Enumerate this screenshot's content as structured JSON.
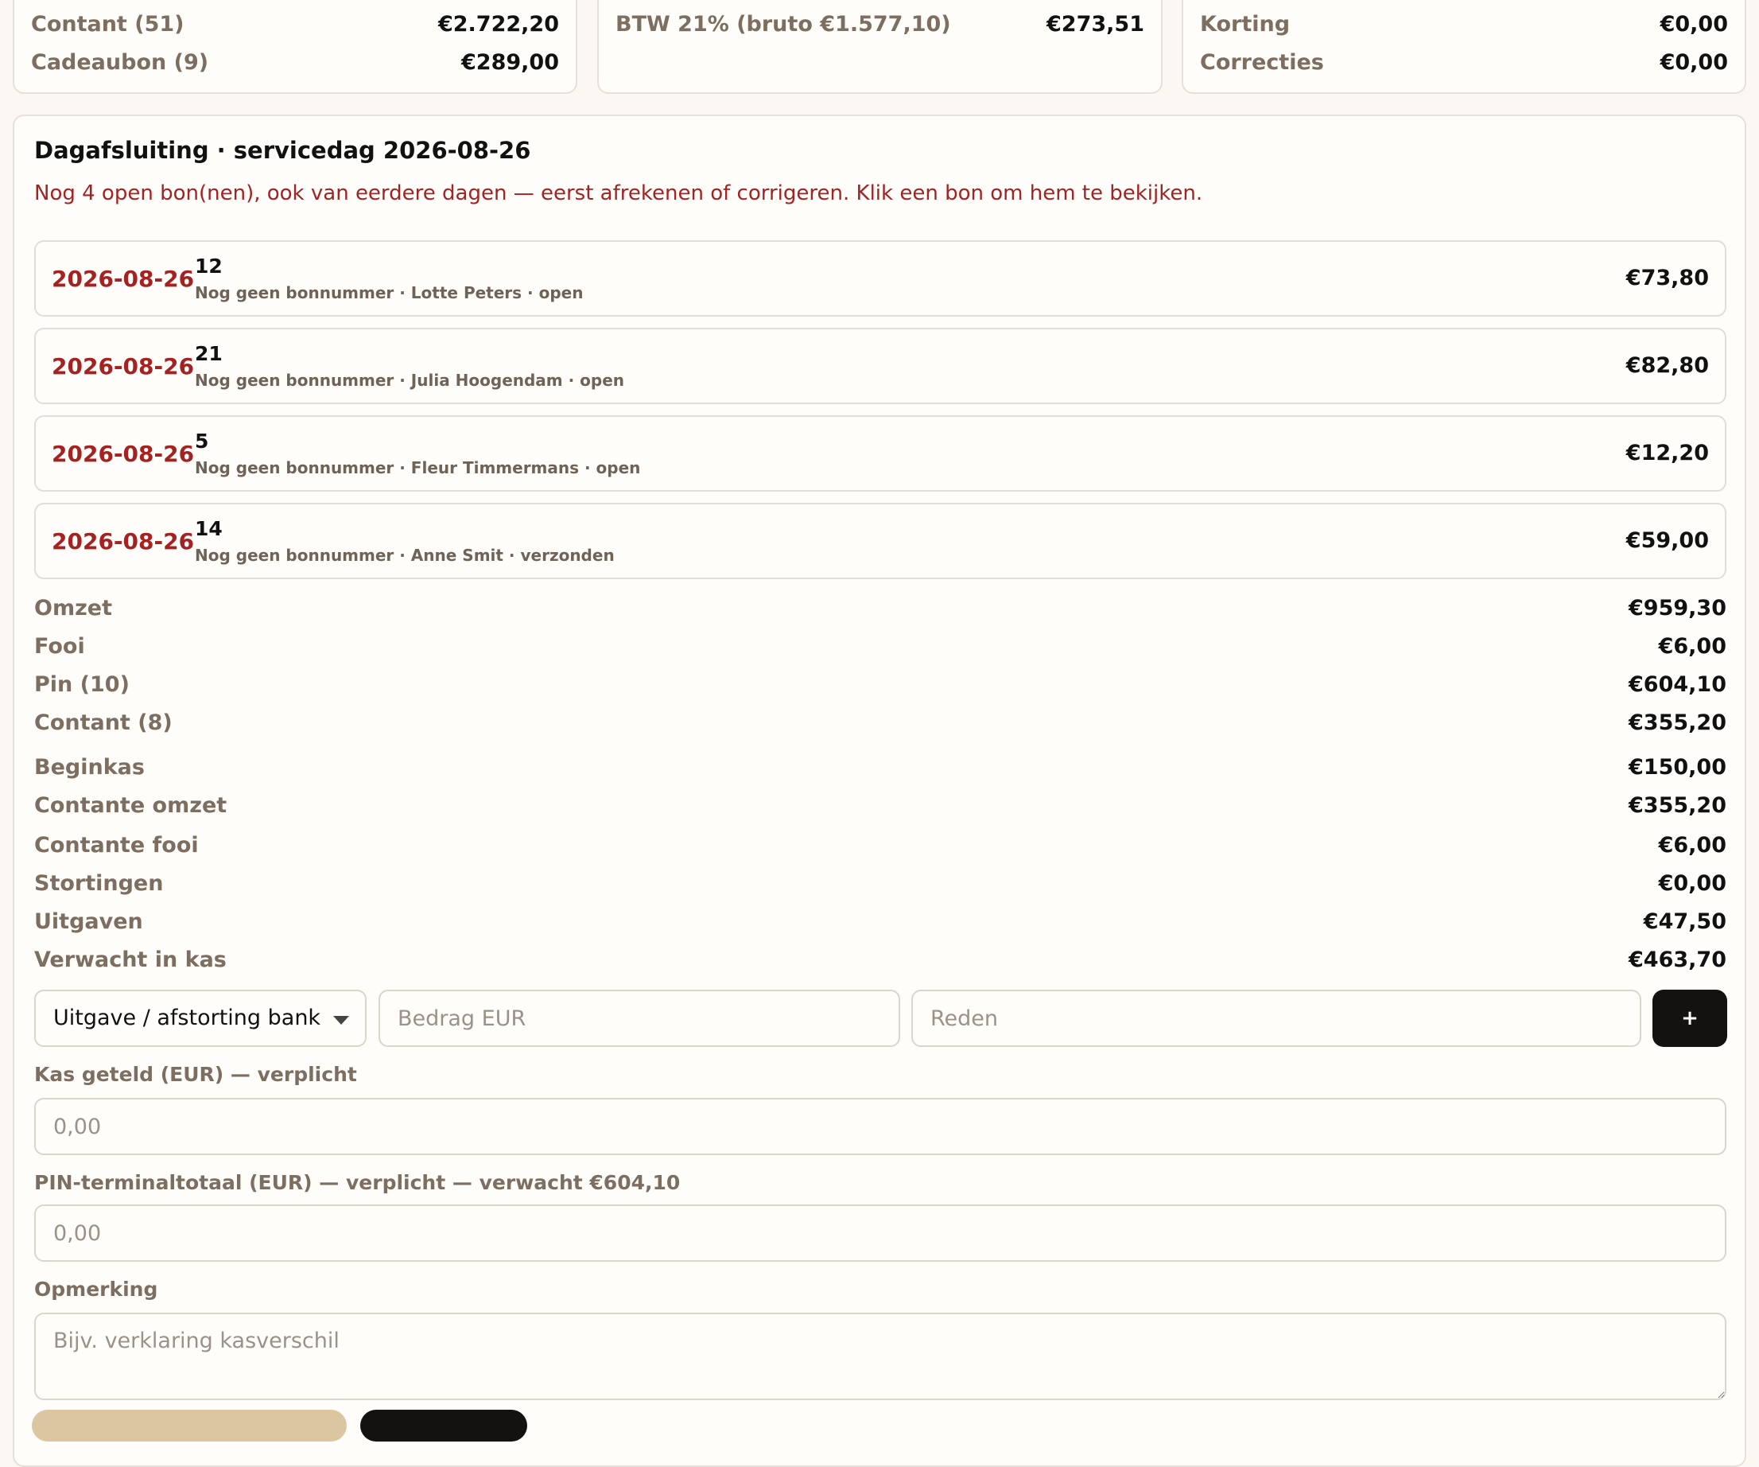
{
  "top_cards": [
    {
      "rows": [
        {
          "label": "Contant (51)",
          "value": "€2.722,20"
        },
        {
          "label": "Cadeaubon (9)",
          "value": "€289,00"
        }
      ]
    },
    {
      "rows": [
        {
          "label": "BTW 21% (bruto €1.577,10)",
          "value": "€273,51"
        }
      ]
    },
    {
      "rows": [
        {
          "label": "Korting",
          "value": "€0,00"
        },
        {
          "label": "Correcties",
          "value": "€0,00"
        }
      ]
    }
  ],
  "closing": {
    "title": "Dagafsluiting · servicedag 2026-08-26",
    "warning": "Nog 4 open bon(nen), ook van eerdere dagen — eerst afrekenen of corrigeren. Klik een bon om hem te bekijken.",
    "bons": [
      {
        "date": "2026-08-26",
        "number": "12",
        "meta": "Nog geen bonnummer · Lotte Peters · open",
        "amount": "€73,80"
      },
      {
        "date": "2026-08-26",
        "number": "21",
        "meta": "Nog geen bonnummer · Julia Hoogendam · open",
        "amount": "€82,80"
      },
      {
        "date": "2026-08-26",
        "number": "5",
        "meta": "Nog geen bonnummer · Fleur Timmermans · open",
        "amount": "€12,20"
      },
      {
        "date": "2026-08-26",
        "number": "14",
        "meta": "Nog geen bonnummer · Anne Smit · verzonden",
        "amount": "€59,00"
      }
    ],
    "summary": [
      {
        "label": "Omzet",
        "value": "€959,30"
      },
      {
        "label": "Fooi",
        "value": "€6,00"
      },
      {
        "label": "Pin (10)",
        "value": "€604,10"
      },
      {
        "label": "Contant (8)",
        "value": "€355,20"
      },
      {
        "label": "Beginkas",
        "value": "€150,00"
      },
      {
        "label": "Contante omzet",
        "value": "€355,20"
      },
      {
        "label": "Contante fooi",
        "value": "€6,00"
      },
      {
        "label": "Stortingen",
        "value": "€0,00"
      },
      {
        "label": "Uitgaven",
        "value": "€47,50"
      },
      {
        "label": "Verwacht in kas",
        "value": "€463,70"
      }
    ],
    "mutation": {
      "type_selected": "Uitgave / afstorting bank",
      "amount_placeholder": "Bedrag EUR",
      "reason_placeholder": "Reden",
      "add_label": "+"
    },
    "cash_counted": {
      "label": "Kas geteld (EUR) — verplicht",
      "placeholder": "0,00"
    },
    "pin_total": {
      "label": "PIN-terminaltotaal (EUR) — verplicht — verwacht €604,10",
      "placeholder": "0,00"
    },
    "remark": {
      "label": "Opmerking",
      "placeholder": "Bijv. verklaring kasverschil"
    }
  }
}
